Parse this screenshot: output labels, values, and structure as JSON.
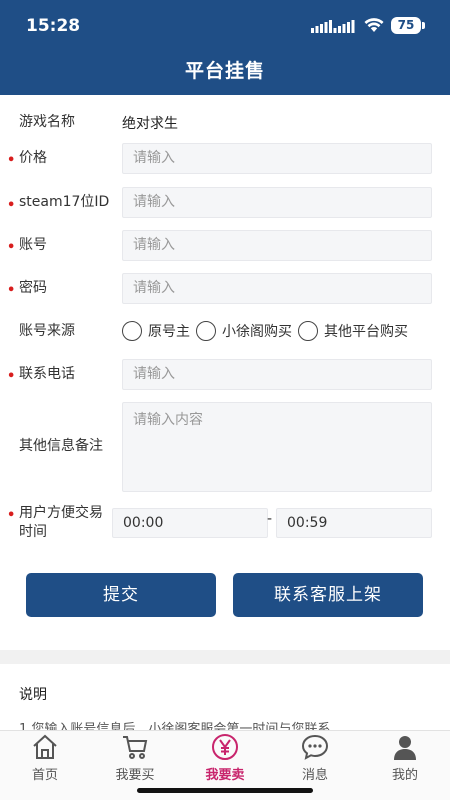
{
  "status": {
    "time": "15:28",
    "battery": "75"
  },
  "header": {
    "title": "平台挂售"
  },
  "form": {
    "game": {
      "label": "游戏名称",
      "value": "绝对求生"
    },
    "price": {
      "label": "价格",
      "placeholder": "请输入"
    },
    "steam_id": {
      "label": "steam17位ID",
      "placeholder": "请输入"
    },
    "account": {
      "label": "账号",
      "placeholder": "请输入"
    },
    "password": {
      "label": "密码",
      "placeholder": "请输入"
    },
    "source": {
      "label": "账号来源",
      "options": [
        "原号主",
        "小徐阁购买",
        "其他平台购买"
      ]
    },
    "phone": {
      "label": "联系电话",
      "placeholder": "请输入"
    },
    "notes": {
      "label": "其他信息备注",
      "placeholder": "请输入内容"
    },
    "trade_time": {
      "label": "用户方便交易时间",
      "start": "00:00",
      "end": "00:59",
      "separator": "-"
    }
  },
  "buttons": {
    "submit": "提交",
    "contact": "联系客服上架"
  },
  "explanation": {
    "title": "说明",
    "text": "1.您输入账号信息后，小徐阁客服会第一时间与您联系"
  },
  "tabs": [
    {
      "label": "首页",
      "icon": "home-icon"
    },
    {
      "label": "我要买",
      "icon": "cart-icon"
    },
    {
      "label": "我要卖",
      "icon": "yen-icon",
      "active": true
    },
    {
      "label": "消息",
      "icon": "message-icon"
    },
    {
      "label": "我的",
      "icon": "user-icon"
    }
  ],
  "colors": {
    "primary": "#1f4e86",
    "required": "#d81e1e",
    "active_tab": "#c8246c"
  }
}
